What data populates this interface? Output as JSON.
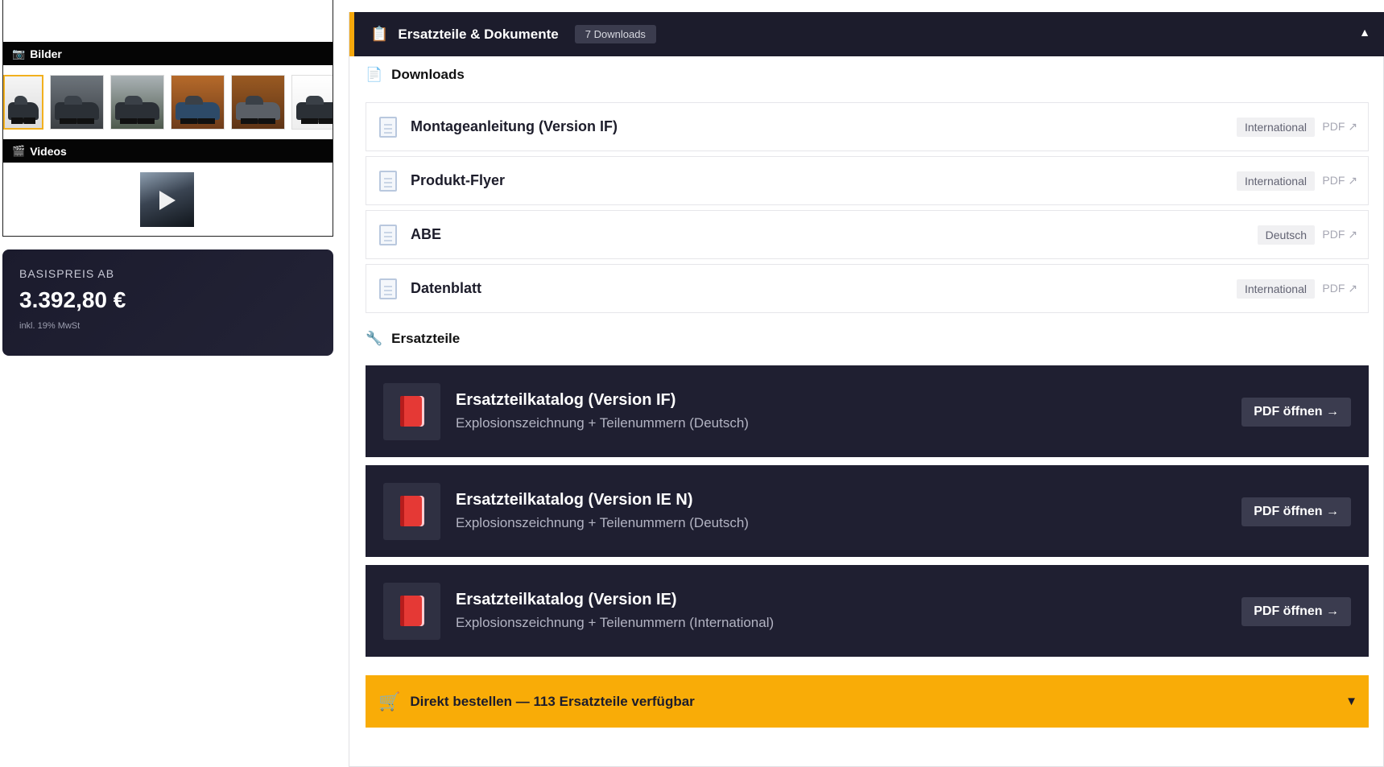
{
  "media": {
    "bilder_label": "Bilder",
    "videos_label": "Videos",
    "bilder_icon": "camera-icon",
    "videos_icon": "clapperboard-icon"
  },
  "price": {
    "label": "BASISPREIS AB",
    "value": "3.392,80 €",
    "note": "inkl. 19% MwSt"
  },
  "panel": {
    "title": "Ersatzteile & Dokumente",
    "count": "7 Downloads",
    "collapse_glyph": "▲"
  },
  "downloads": {
    "title": "Downloads",
    "items": [
      {
        "name": "Montageanleitung (Version IF)",
        "lang": "International",
        "type": "PDF ↗"
      },
      {
        "name": "Produkt-Flyer",
        "lang": "International",
        "type": "PDF ↗"
      },
      {
        "name": "ABE",
        "lang": "Deutsch",
        "type": "PDF ↗"
      },
      {
        "name": "Datenblatt",
        "lang": "International",
        "type": "PDF ↗"
      }
    ]
  },
  "parts": {
    "title": "Ersatzteile",
    "catalogs": [
      {
        "title": "Ersatzteilkatalog (Version IF)",
        "subtitle": "Explosionszeichnung + Teilenummern (Deutsch)",
        "button": "PDF öffnen →"
      },
      {
        "title": "Ersatzteilkatalog (Version IE N)",
        "subtitle": "Explosionszeichnung + Teilenummern (Deutsch)",
        "button": "PDF öffnen →"
      },
      {
        "title": "Ersatzteilkatalog (Version IE)",
        "subtitle": "Explosionszeichnung + Teilenummern (International)",
        "button": "PDF öffnen →"
      }
    ]
  },
  "order": {
    "text": "Direkt bestellen — 113 Ersatzteile verfügbar",
    "expand_glyph": "▼"
  },
  "colors": {
    "accent": "#f6a80b",
    "dark": "#1c1c2c",
    "order_bar": "#f9ac07"
  }
}
